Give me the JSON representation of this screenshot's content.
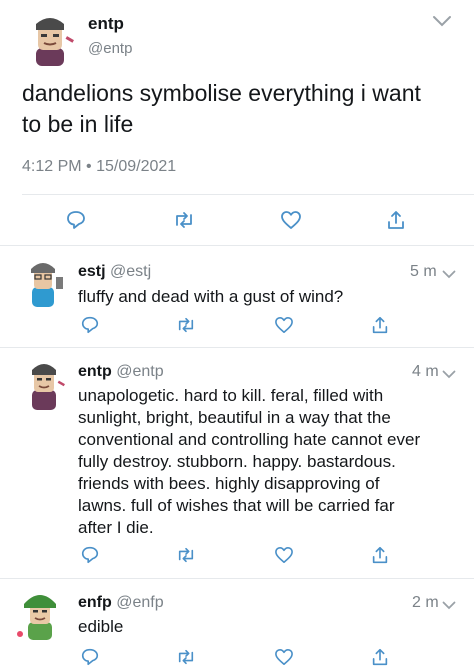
{
  "main_tweet": {
    "display_name": "entp",
    "handle": "@entp",
    "text_line1": "dandelions symbolise everything i want",
    "text_line2": "to be in life",
    "timestamp": "4:12 PM • 15/09/2021"
  },
  "replies": [
    {
      "display_name": "estj",
      "handle": "@estj",
      "time": "5 m",
      "lines": [
        "fluffy and dead with a gust of wind?"
      ]
    },
    {
      "display_name": "entp",
      "handle": "@entp",
      "time": "4 m",
      "lines": [
        "unapologetic. hard to kill. feral, filled with",
        "sunlight, bright, beautiful in a way that the",
        "conventional and controlling hate cannot ever",
        "fully destroy. stubborn. happy. bastardous.",
        "friends with bees. highly disapproving of",
        "lawns. full of wishes that will be carried far",
        "after I die."
      ]
    },
    {
      "display_name": "enfp",
      "handle": "@enfp",
      "time": "2 m",
      "lines": [
        "edible"
      ]
    }
  ],
  "icons": {
    "reply": "reply-icon",
    "retweet": "retweet-icon",
    "like": "heart-icon",
    "share": "share-icon",
    "more": "chevron-down-icon"
  },
  "colors": {
    "text": "#14171a",
    "muted": "#7b8288",
    "icon": "#4a90c8",
    "divider": "#e6e9ec"
  }
}
